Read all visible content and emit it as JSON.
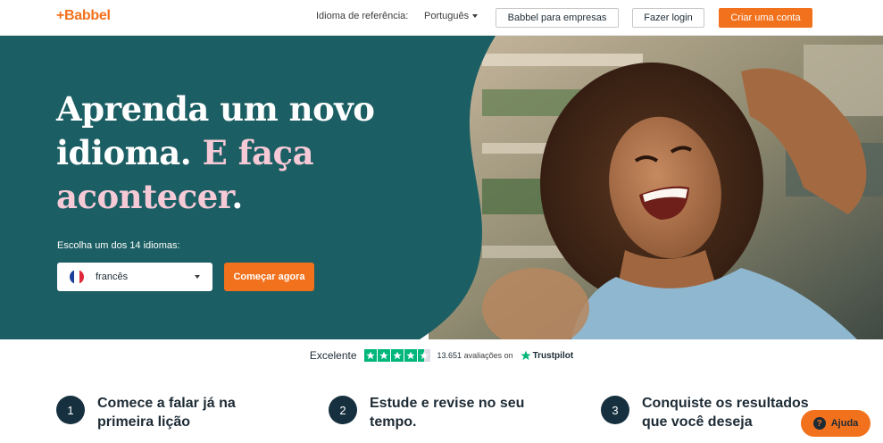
{
  "header": {
    "logo": "+Babbel",
    "reference_language_label": "Idioma de referência:",
    "reference_language_value": "Português",
    "business_button": "Babbel para empresas",
    "login_button": "Fazer login",
    "signup_button": "Criar uma conta"
  },
  "hero": {
    "headline_part1": "Aprenda um novo idioma.",
    "headline_part2": "E faça acontecer.",
    "headline_line1": "Aprenda um novo",
    "headline_line2a": "idioma.",
    "headline_line2b": "E faça",
    "headline_line3a": "acontecer",
    "headline_line3b": ".",
    "choose_label": "Escolha um dos 14 idiomas:",
    "selected_language": "francês",
    "start_button": "Começar agora",
    "colors": {
      "panel": "#1b5e63",
      "accent_text": "#f6c9d6",
      "cta": "#f2711c"
    }
  },
  "trustpilot": {
    "rating_word": "Excelente",
    "stars": 4.5,
    "review_count": "13.651",
    "reviews_suffix": "avaliações on",
    "brand": "Trustpilot"
  },
  "steps": [
    {
      "number": "1",
      "text": "Comece a falar já na primeira lição"
    },
    {
      "number": "2",
      "text": "Estude e revise no seu tempo."
    },
    {
      "number": "3",
      "text": "Conquiste os resultados que você deseja"
    }
  ],
  "help": {
    "label": "Ajuda",
    "icon": "?"
  }
}
